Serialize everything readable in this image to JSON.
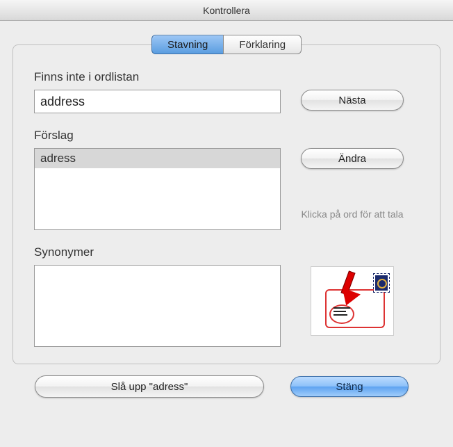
{
  "window": {
    "title": "Kontrollera"
  },
  "tabs": {
    "spelling": "Stavning",
    "explanation": "Förklaring"
  },
  "labels": {
    "not_in_dict": "Finns inte i ordlistan",
    "suggestions": "Förslag",
    "synonyms": "Synonymer"
  },
  "fields": {
    "word_value": "address"
  },
  "suggestions": [
    "adress"
  ],
  "buttons": {
    "next": "Nästa",
    "change": "Ändra",
    "lookup": "Slå upp \"adress\"",
    "close": "Stäng"
  },
  "hint": "Klicka på ord för att tala"
}
